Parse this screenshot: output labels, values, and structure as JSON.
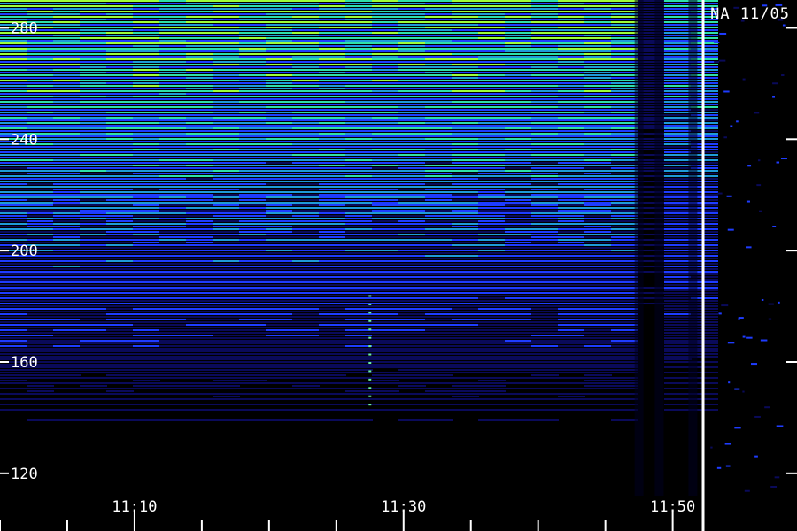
{
  "chart_data": {
    "type": "heatmap",
    "title": "",
    "station_label": "NA 11/05",
    "xlabel": "",
    "ylabel": "",
    "x_axis": {
      "kind": "time",
      "ticks": [
        {
          "value": "11:10",
          "minutes": 70
        },
        {
          "value": "11:30",
          "minutes": 90
        },
        {
          "value": "11:50",
          "minutes": 110
        }
      ],
      "range_minutes": [
        60,
        112
      ],
      "minor_tick_step_minutes": 5
    },
    "y_axis": {
      "ticks": [
        120,
        160,
        200,
        240,
        280
      ],
      "range": [
        112,
        290
      ]
    },
    "intensity_colors": [
      "#000000",
      "#0a0a5a",
      "#1e3cff",
      "#1e9ad8",
      "#2ee0a8",
      "#9cff3a"
    ],
    "features": {
      "emission_band_top": "strong green emission near top frequencies, fading toward lower frequencies",
      "dark_lanes_minutes": [
        107.5,
        109,
        111.5
      ],
      "burst_minute": 87.5,
      "burst_range": [
        145,
        185
      ]
    },
    "grid": false,
    "legend": "none"
  }
}
